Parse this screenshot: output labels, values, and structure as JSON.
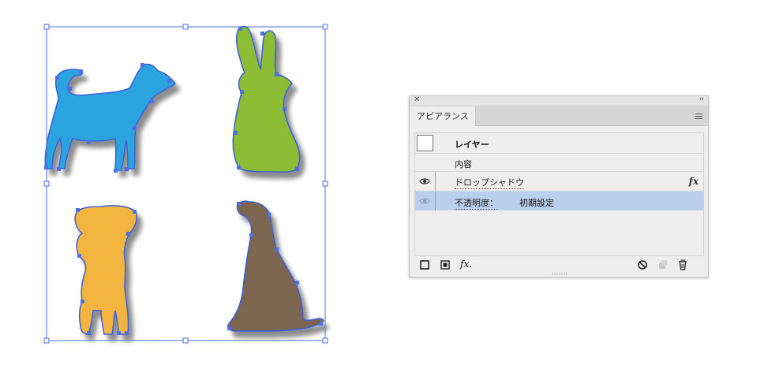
{
  "panel": {
    "tab_label": "アピアランス",
    "close_glyph": "✕",
    "collapse_glyph": "‹‹",
    "rows": {
      "layer_label": "レイヤー",
      "content_label": "内容",
      "effect_label": "ドロップシャドウ",
      "fx_glyph": "fx",
      "opacity_label": "不透明度：",
      "opacity_value": "初期設定"
    },
    "toolbar": {
      "new_stroke": "square-outline-icon",
      "new_fill": "square-filled-icon",
      "add_effect_label": "fx.",
      "clear_appearance": "no-entry-icon",
      "duplicate": "duplicate-icon",
      "delete": "trash-icon"
    }
  },
  "colors": {
    "dog_left": "#2aa3de",
    "rabbit": "#8bbd36",
    "pup": "#f4b440",
    "sitting_dog": "#7b6650",
    "selection": "#4a6fe8",
    "selected_row": "#b9cfeb"
  }
}
